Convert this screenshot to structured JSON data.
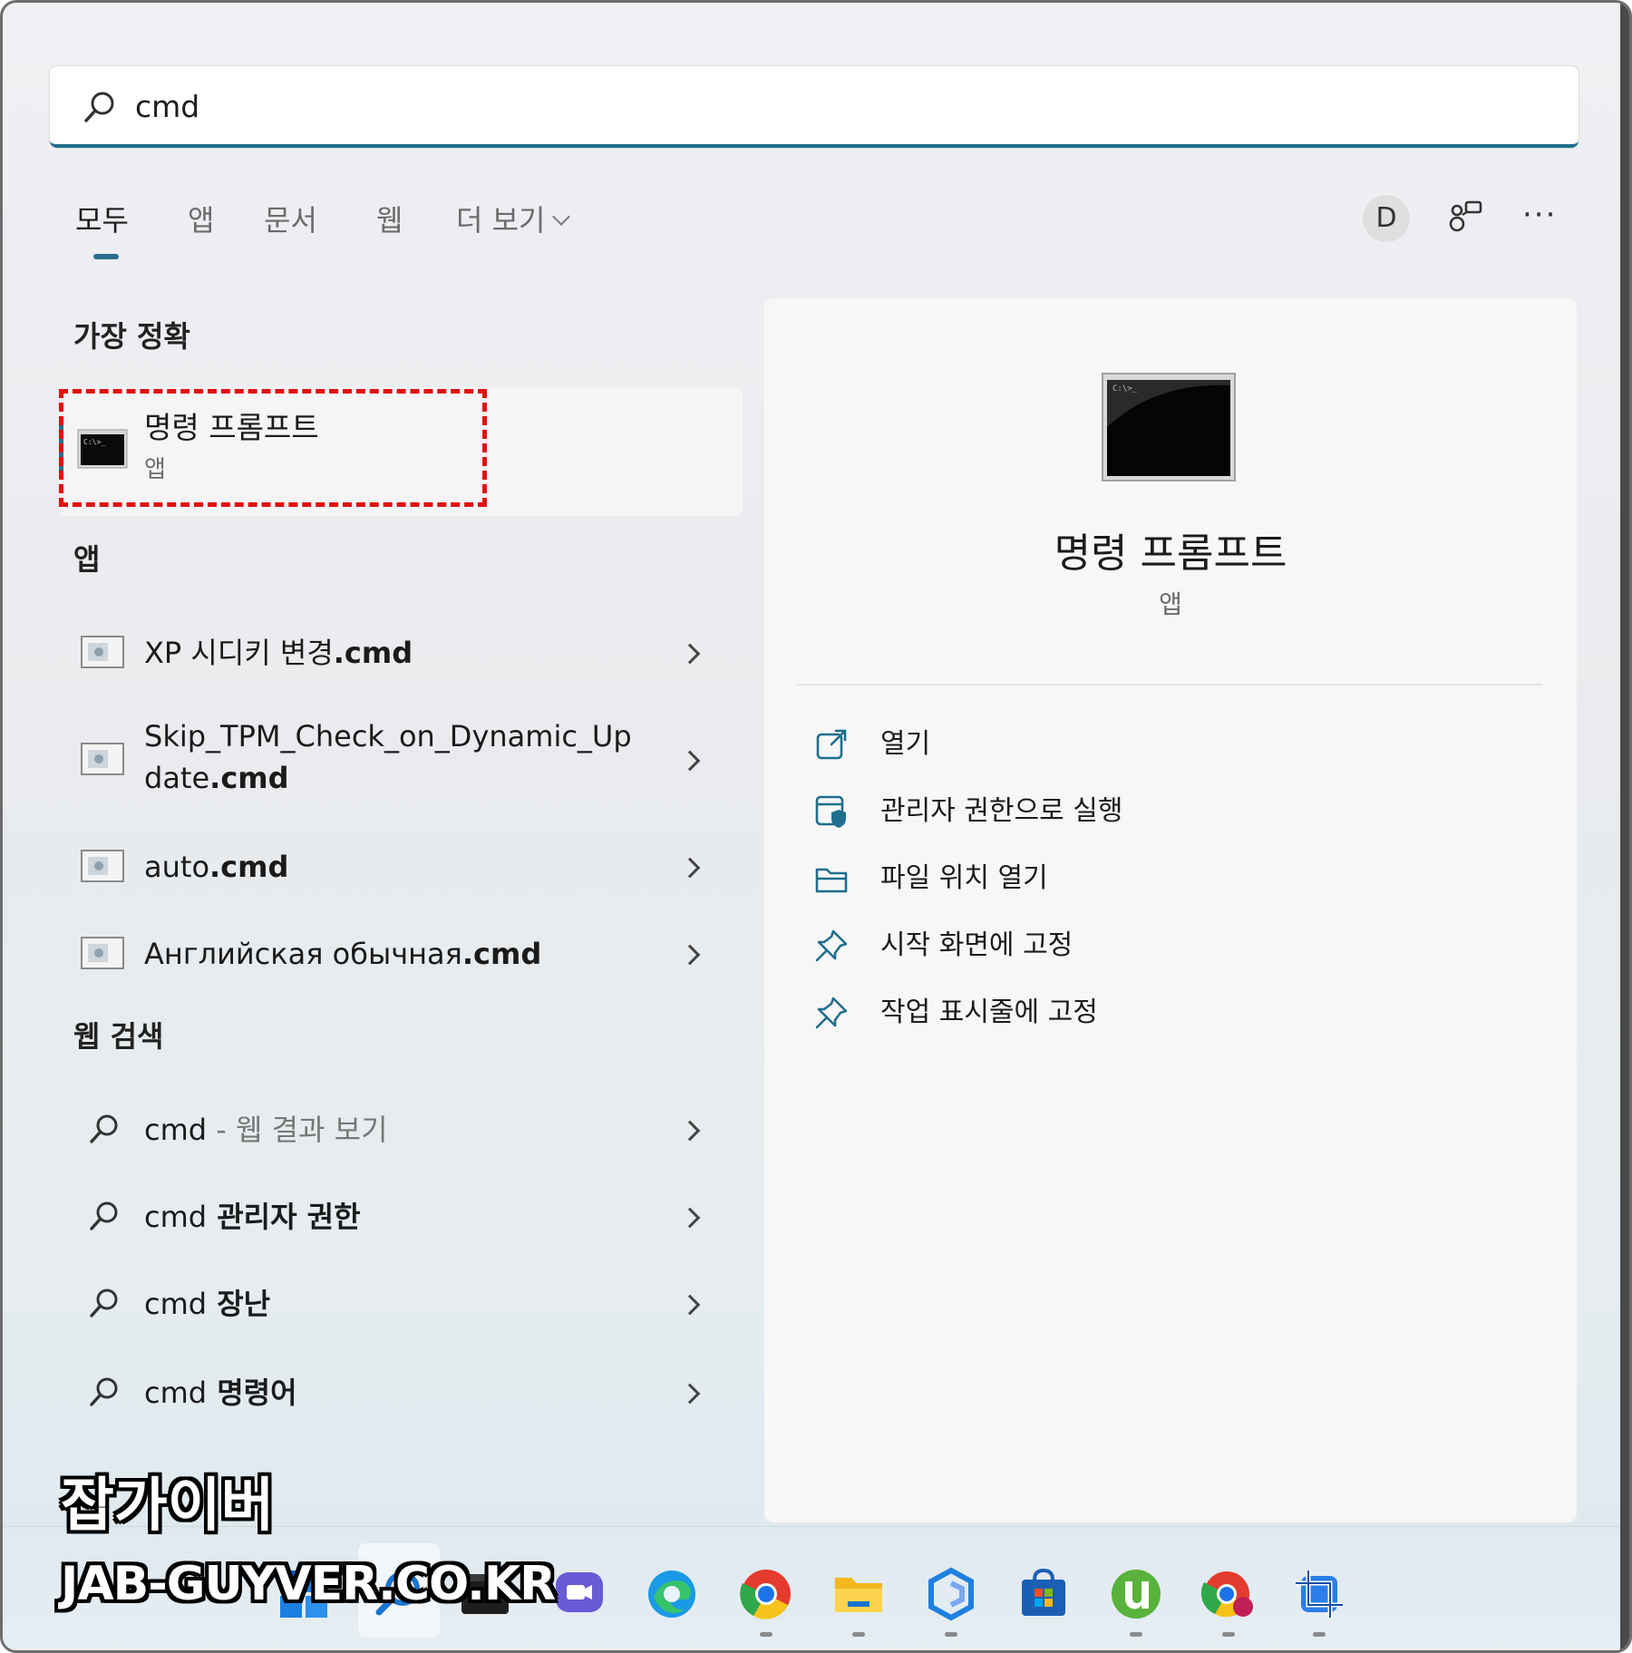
{
  "search": {
    "query": "cmd"
  },
  "tabs": [
    {
      "label": "모두",
      "active": true
    },
    {
      "label": "앱"
    },
    {
      "label": "문서"
    },
    {
      "label": "웹"
    },
    {
      "label": "더 보기"
    }
  ],
  "header_actions": {
    "avatar_letter": "D",
    "more": "···"
  },
  "best_match": {
    "section_title": "가장 정확",
    "name": "명령 프롬프트",
    "type": "앱"
  },
  "apps": {
    "section_title": "앱",
    "items": [
      {
        "prefix": "XP 시디키 변경",
        "suffix": ".cmd"
      },
      {
        "prefix": "Skip_TPM_Check_on_Dynamic_Up",
        "line2_prefix": "date",
        "suffix": ".cmd"
      },
      {
        "prefix": "auto",
        "suffix": ".cmd"
      },
      {
        "prefix": "Английская обычная",
        "suffix": ".cmd"
      }
    ]
  },
  "web_search": {
    "section_title": "웹 검색",
    "items": [
      {
        "query": "cmd",
        "rest": " - 웹 결과 보기",
        "rest_muted": true
      },
      {
        "query": "cmd",
        "rest": " 관리자 권한",
        "rest_muted": false
      },
      {
        "query": "cmd",
        "rest": " 장난",
        "rest_muted": false
      },
      {
        "query": "cmd",
        "rest": " 명령어",
        "rest_muted": false
      }
    ]
  },
  "detail": {
    "title": "명령 프롬프트",
    "type": "앱",
    "actions": [
      {
        "label": "열기",
        "icon": "open-external-icon"
      },
      {
        "label": "관리자 권한으로 실행",
        "icon": "shield-admin-icon"
      },
      {
        "label": "파일 위치 열기",
        "icon": "folder-icon"
      },
      {
        "label": "시작 화면에 고정",
        "icon": "pin-icon"
      },
      {
        "label": "작업 표시줄에 고정",
        "icon": "pin-icon"
      }
    ]
  },
  "taskbar": {
    "icons": [
      "windows-start-icon",
      "search-icon",
      "terminal-icon",
      "teams-chat-icon",
      "edge-icon",
      "chrome-icon",
      "file-explorer-icon",
      "copilot-icon",
      "store-icon",
      "utorrent-icon",
      "chrome-profile-icon",
      "snipping-tool-icon"
    ]
  },
  "watermark": {
    "line1": "잡가이버",
    "line2": "JAB-GUYVER.CO.KR"
  },
  "colors": {
    "accent": "#2a6f8f",
    "highlight_dash": "#e01010"
  }
}
